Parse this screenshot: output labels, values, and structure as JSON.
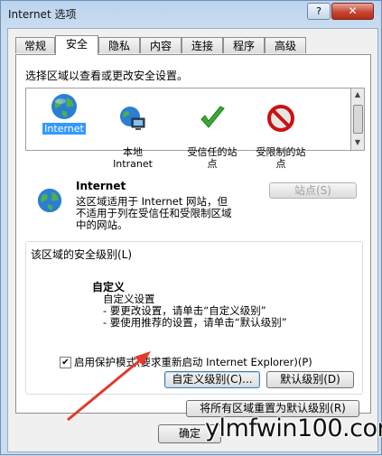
{
  "window": {
    "title": "Internet 选项",
    "help_label": "?",
    "close_label": "✕"
  },
  "tabs": [
    "常规",
    "安全",
    "隐私",
    "内容",
    "连接",
    "程序",
    "高级"
  ],
  "security": {
    "instruction": "选择区域以查看或更改安全设置。",
    "zones": [
      {
        "label": "Internet",
        "icon": "globe-icon"
      },
      {
        "label": "本地\nIntranet",
        "icon": "intranet-icon"
      },
      {
        "label": "受信任的站\n点",
        "icon": "check-icon"
      },
      {
        "label": "受限制的站\n点",
        "icon": "restricted-icon"
      }
    ],
    "zone_title": "Internet",
    "zone_desc": "这区域适用于 Internet 网站，但\n不适用于列在受信任和受限制区域\n中的网站。",
    "sites_button": "站点(S)",
    "level_group_label": "该区域的安全级别(L)",
    "level_name": "自定义",
    "level_desc": "自定义设置\n- 要更改设置，请单击“自定义级别”\n- 要使用推荐的设置，请单击“默认级别”",
    "protected_mode_label": "启用保护模式(要求重新启动 Internet Explorer)(P)",
    "protected_mode_checked": true,
    "custom_level_button": "自定义级别(C)...",
    "default_level_button": "默认级别(D)",
    "reset_all_button": "将所有区域重置为默认级别(R)"
  },
  "footer": {
    "ok_button": "确定"
  },
  "watermark": "ylmfwin100.com",
  "colors": {
    "annotation_arrow": "#e23a2e",
    "selection": "#3399ff"
  }
}
